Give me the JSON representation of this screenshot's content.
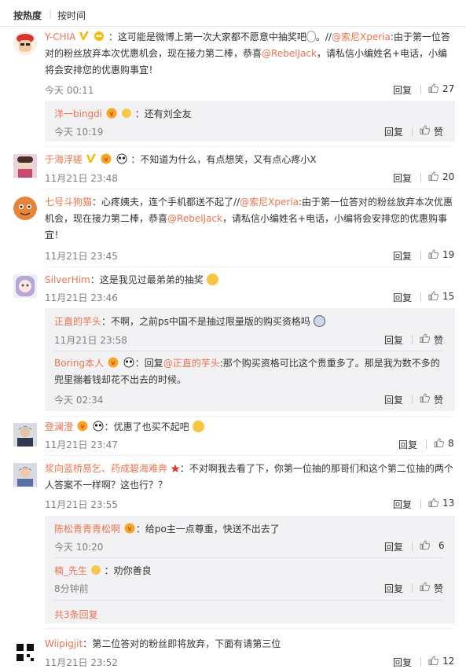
{
  "sort": {
    "hot": "按热度",
    "time": "按时间"
  },
  "ui": {
    "reply": "回复",
    "like": "赞"
  },
  "comments": [
    {
      "user": "Y-CHIA",
      "segments": [
        "：这可能是微博上第一次大家都不愿意中抽奖吧",
        "。//",
        "@索尼Xperia",
        ":由于第一位答对的粉丝放弃本次优惠机会，现在接力第二棒，恭喜",
        "@RebelJack",
        "，请私信小编姓名+电话，小编将会安排您的优惠购事宜！"
      ],
      "time": "今天 00:11",
      "likes": "27"
    },
    {
      "user": "于海浮槎",
      "text": "：不知道为什么，有点想笑，又有点心疼小X",
      "time": "11月21日 23:48",
      "likes": "20"
    },
    {
      "user": "七号斗狗猫",
      "segments": [
        "：心疼姨夫，连个手机都送不起了//",
        "@索尼Xperia",
        ":由于第一位答对的粉丝放弃本次优惠机会，现在接力第二棒，恭喜",
        "@RebelJack",
        "，请私信小编姓名+电话，小编将会安排您的优惠购事宜！"
      ],
      "time": "11月21日 23:45",
      "likes": "19"
    },
    {
      "user": "SilverHim",
      "text": "：这是我见过最弟弟的抽奖",
      "time": "11月21日 23:46",
      "likes": "15"
    },
    {
      "user": "登澜澄",
      "text": "：优惠了也买不起吧",
      "time": "11月21日 23:47",
      "likes": "8"
    },
    {
      "user": "浆向蓝桥易乞、药成碧海难奔",
      "text": "：不对啊我去看了下，你第一位抽的那哥们和这个第二位抽的两个人答案不一样啊？这也行？？",
      "time": "11月21日 23:55",
      "likes": "13"
    },
    {
      "user": "Wiipigjit",
      "text": "：第二位答对的粉丝即将放弃，下面有请第三位",
      "time": "11月21日 23:52",
      "likes": "12"
    }
  ],
  "subs": [
    {
      "user": "洋一bingdi",
      "text": "：还有刘全友",
      "time": "今天 10:19",
      "likes": "赞"
    },
    {
      "user": "正直的芋头",
      "text": "：不啊，之前ps中国不是抽过限量版的购买资格吗",
      "time": "11月21日 23:58",
      "likes": "赞"
    },
    {
      "user": "Boring本人",
      "segments": [
        "：回复",
        "@正直的芋头",
        ":那个购买资格可比这个贵重多了。那是我为数不多的兜里揣着钱却花不出去的时候。"
      ],
      "time": "今天 02:34",
      "likes": "赞"
    },
    {
      "user": "陈松青青青松啊",
      "text": "：给po主一点尊重，快送不出去了",
      "time": "今天 10:20",
      "likes": "6"
    },
    {
      "user": "楠_先生",
      "text": "：劝你善良",
      "time": "8分钟前",
      "likes": "赞"
    }
  ],
  "more": "共3条回复",
  "colors": {
    "link": "#eb7350",
    "text": "#333333",
    "time": "#808080",
    "subbg": "#f2f2f5"
  }
}
